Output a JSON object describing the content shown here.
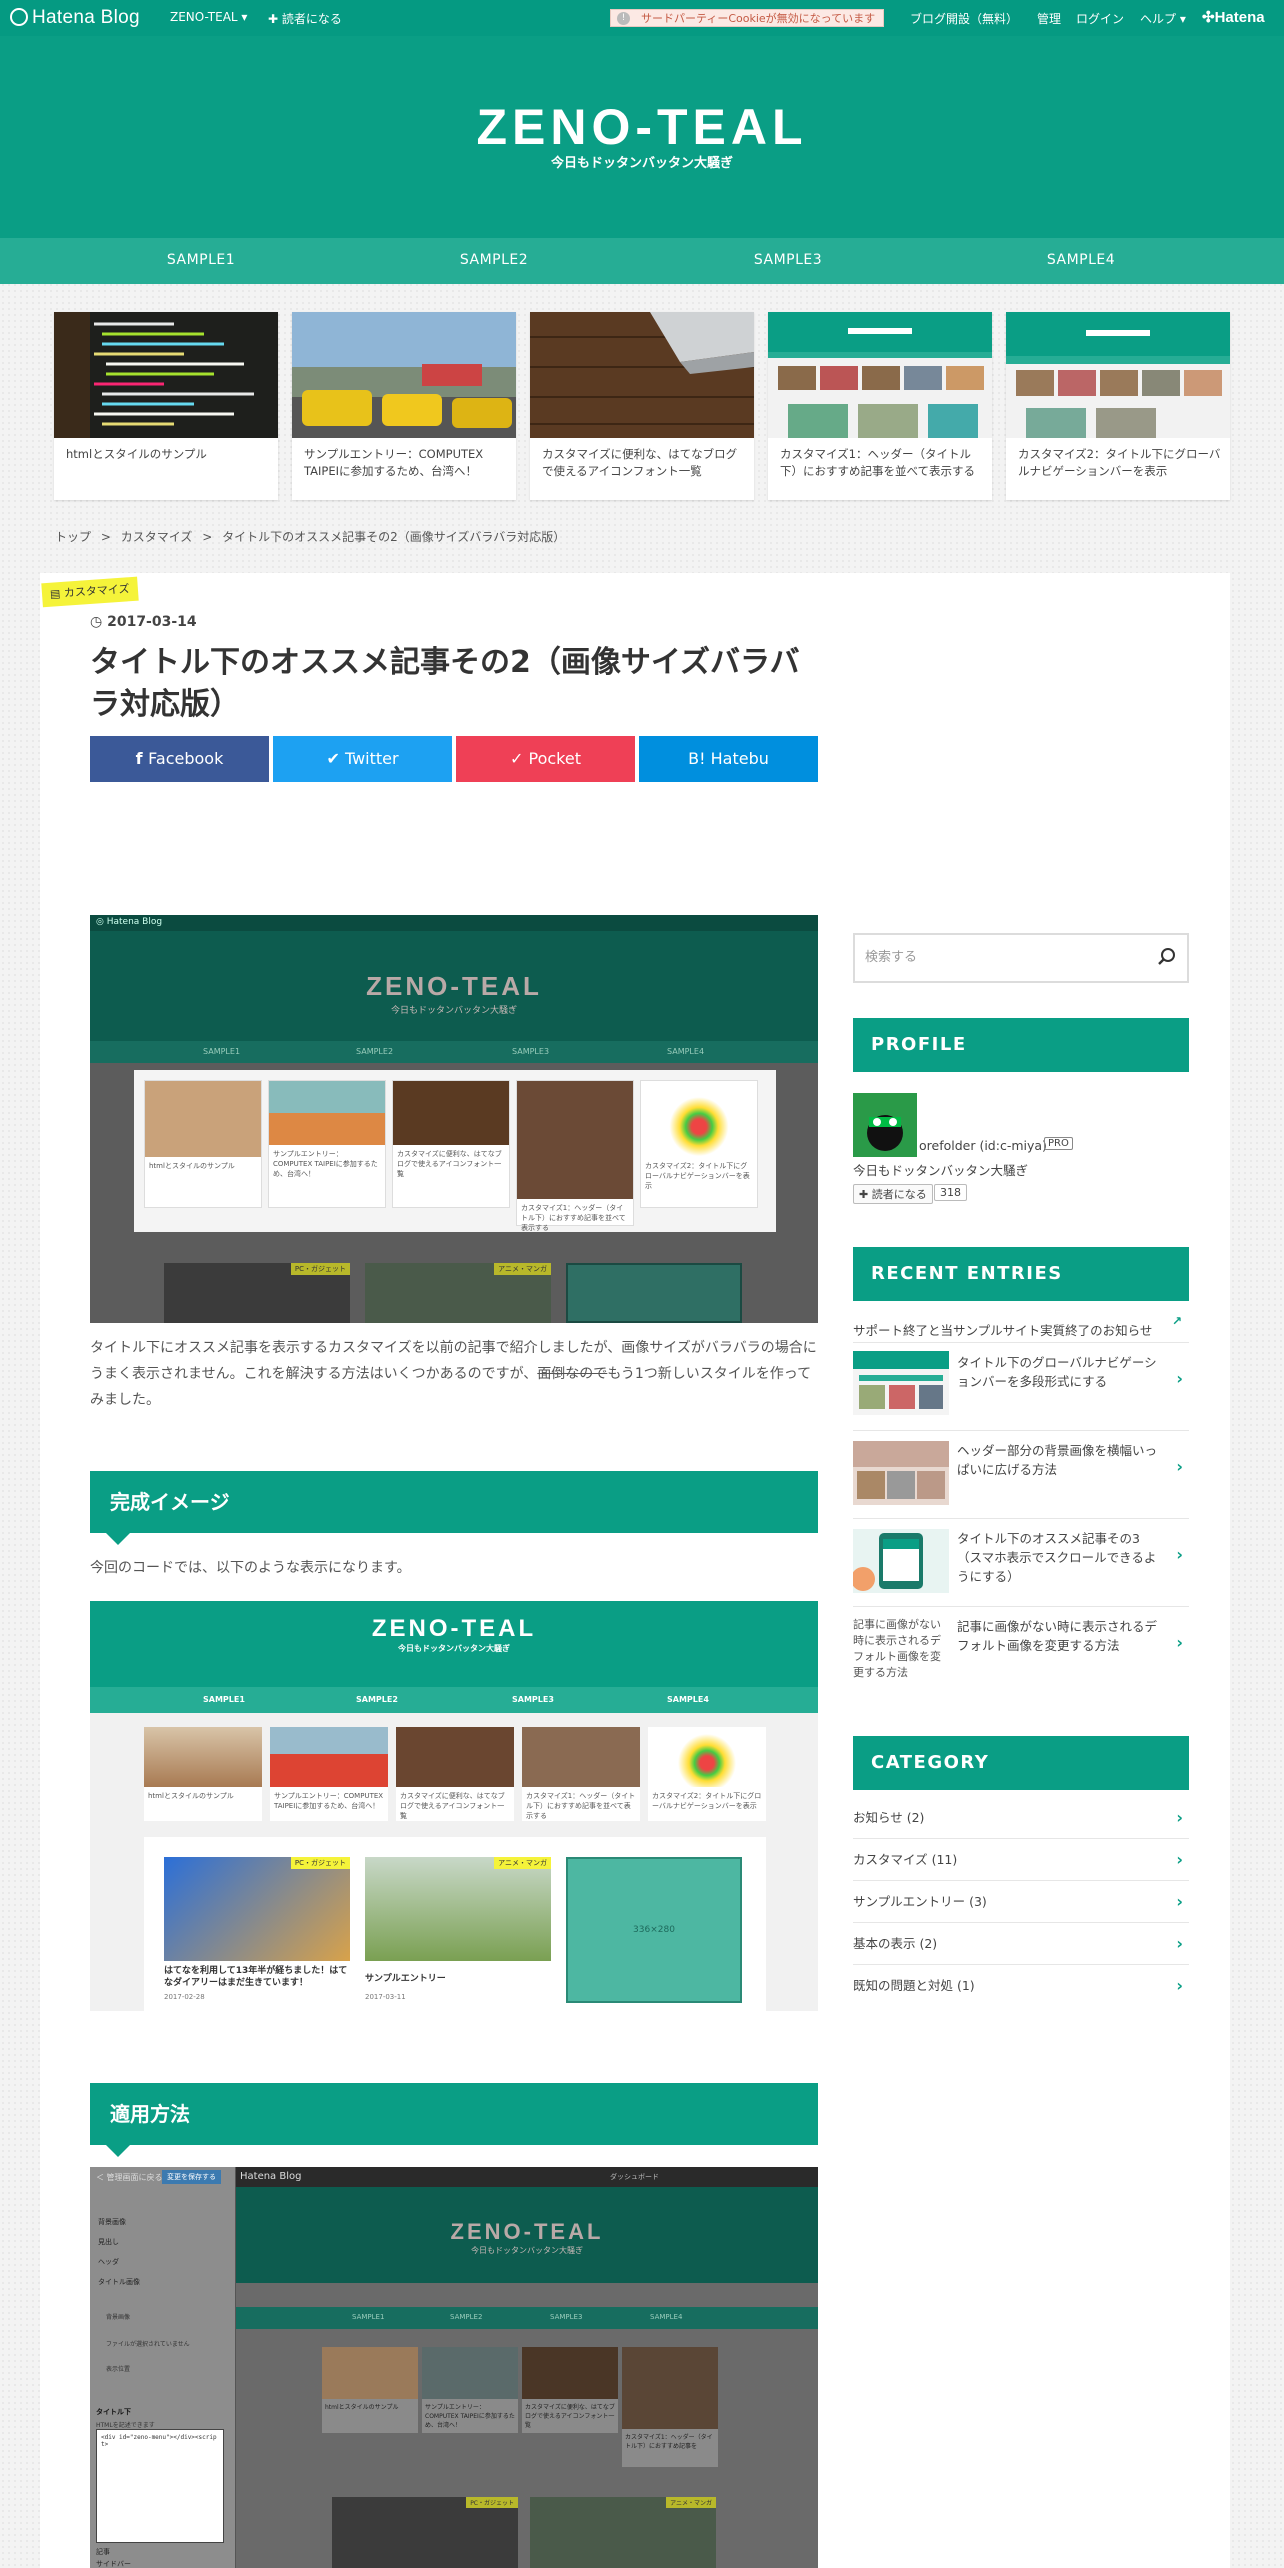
{
  "topbar": {
    "logo": "Hatena Blog",
    "blog_menu": "ZENO-TEAL ▾",
    "subscribe": "✚ 読者になる",
    "cookie_notice": "サードパーティーCookieが無効になっています",
    "open_blog": "ブログ開設（無料）",
    "admin": "管理",
    "login": "ログイン",
    "help": "ヘルプ ▾",
    "hatena": "Hatena"
  },
  "header": {
    "title": "ZENO-TEAL",
    "subtitle": "今日もドッタンバッタン大騒ぎ"
  },
  "nav": [
    "SAMPLE1",
    "SAMPLE2",
    "SAMPLE3",
    "SAMPLE4"
  ],
  "recommended": [
    {
      "caption": "htmlとスタイルのサンプル"
    },
    {
      "caption": "サンプルエントリー：COMPUTEX TAIPEIに参加するため、台湾へ！"
    },
    {
      "caption": "カスタマイズに便利な、はてなブログで使えるアイコンフォント一覧"
    },
    {
      "caption": "カスタマイズ1：ヘッダー（タイトル下）におすすめ記事を並べて表示する"
    },
    {
      "caption": "カスタマイズ2：タイトル下にグローバルナビゲーションバーを表示"
    }
  ],
  "breadcrumb": {
    "top": "トップ",
    "sep": ">",
    "category": "カスタマイズ",
    "current": "タイトル下のオススメ記事その2（画像サイズバラバラ対応版）"
  },
  "entry": {
    "category_tag": "カスタマイズ",
    "date": "2017-03-14",
    "title": "タイトル下のオススメ記事その2（画像サイズバラバラ対応版）",
    "share": {
      "facebook": "Facebook",
      "twitter": "Twitter",
      "pocket": "Pocket",
      "hatebu": "Hatebu"
    },
    "intro_before": "タイトル下にオススメ記事を表示するカスタマイズを以前の記事で紹介しましたが、画像サイズがバラバラの場合にうまく表示されません。これを解決する方法はいくつかあるのですが、",
    "intro_strike": "面倒なので",
    "intro_after": "もう1つ新しいスタイルを作ってみました。",
    "h2_result": "完成イメージ",
    "result_text": "今回のコードでは、以下のような表示になります。",
    "h2_apply": "適用方法"
  },
  "screenshot1": {
    "title": "ZENO-TEAL",
    "subtitle": "今日もドッタンバッタン大騒ぎ",
    "nav": [
      "SAMPLE1",
      "SAMPLE2",
      "SAMPLE3",
      "SAMPLE4"
    ],
    "captions": [
      "htmlとスタイルのサンプル",
      "サンプルエントリー：COMPUTEX TAIPEIに参加するため、台湾へ！",
      "カスタマイズに便利な、はてなブログで使えるアイコンフォント一覧",
      "カスタマイズ1：ヘッダー（タイトル下）におすすめ記事を並べて表示する",
      "カスタマイズ2：タイトル下にグローバルナビゲーションバーを表示"
    ],
    "badge1": "PC・ガジェット",
    "badge2": "アニメ・マンガ"
  },
  "screenshot2": {
    "title": "ZENO-TEAL",
    "subtitle": "今日もドッタンバッタン大騒ぎ",
    "nav": [
      "SAMPLE1",
      "SAMPLE2",
      "SAMPLE3",
      "SAMPLE4"
    ],
    "captions": [
      "htmlとスタイルのサンプル",
      "サンプルエントリー：COMPUTEX TAIPEIに参加するため、台湾へ！",
      "カスタマイズに便利な、はてなブログで使えるアイコンフォント一覧",
      "カスタマイズ1：ヘッダー（タイトル下）におすすめ記事を並べて表示する",
      "カスタマイズ2：タイトル下にグローバルナビゲーションバーを表示"
    ],
    "badge1": "PC・ガジェット",
    "badge2": "アニメ・マンガ",
    "post1_title": "はてなを利用して13年半が経ちました！はてなダイアリーはまだ生きています！",
    "post1_date": "2017-02-28",
    "post2_title": "サンプルエントリー",
    "post2_date": "2017-03-11",
    "placeholder": "336×280"
  },
  "screenshot3": {
    "back": "＜ 管理画面に戻る",
    "save": "変更を保存する",
    "menu": [
      "背景画像",
      "見出し",
      "ヘッダ",
      "タイトル画像",
      "背景画像",
      "表示位置",
      "タイトル下",
      "記事",
      "サイドバー"
    ],
    "upload_note": "ファイルが選択されていません",
    "html_note": "HTMLを記述できます",
    "code": "<div id=\"zeno-menu\"></div><script>",
    "header_logo": "Hatena Blog",
    "dashboard": "ダッシュボード",
    "title": "ZENO-TEAL",
    "subtitle": "今日もドッタンバッタン大騒ぎ",
    "nav": [
      "SAMPLE1",
      "SAMPLE2",
      "SAMPLE3",
      "SAMPLE4"
    ],
    "captions": [
      "htmlとスタイルのサンプル",
      "サンプルエントリー：COMPUTEX TAIPEIに参加するため、台湾へ！",
      "カスタマイズに便利な、はてなブログで使えるアイコンフォント一覧",
      "カスタマイズ1：ヘッダー（タイトル下）におすすめ記事を"
    ],
    "badge1": "PC・ガジェット",
    "badge2": "アニメ・マンガ"
  },
  "sidebar": {
    "search_placeholder": "検索する",
    "profile_title": "PROFILE",
    "profile_name": "orefolder (id:c-miya)",
    "pro_badge": "PRO",
    "profile_desc": "今日もドッタンバッタン大騒ぎ",
    "subscribe": "✚ 読者になる",
    "subscribers": "318",
    "recent_title": "RECENT ENTRIES",
    "recent": [
      "サポート終了と当サンプルサイト実質終了のお知らせ",
      "タイトル下のグローバルナビゲーションバーを多段形式にする",
      "ヘッダー部分の背景画像を横幅いっぱいに広げる方法",
      "タイトル下のオススメ記事その3（スマホ表示でスクロールできるようにする）",
      "記事に画像がない時に表示されるデフォルト画像を変更する方法"
    ],
    "recent_alt": "記事に画像がない時に表示されるデフォルト画像を変更する方法",
    "category_title": "CATEGORY",
    "categories": [
      "お知らせ (2)",
      "カスタマイズ (11)",
      "サンプルエントリー (3)",
      "基本の表示 (2)",
      "既知の問題と対処 (1)"
    ]
  }
}
